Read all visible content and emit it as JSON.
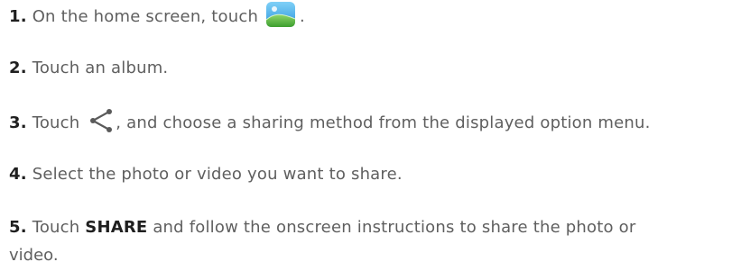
{
  "steps": [
    {
      "number": "1.",
      "text_before": "On the home screen, touch",
      "icon": "gallery-icon",
      "text_after": "."
    },
    {
      "number": "2.",
      "text": "Touch an album."
    },
    {
      "number": "3.",
      "text_before": "Touch",
      "icon": "share-icon",
      "text_after": ", and choose a sharing method from the displayed option menu."
    },
    {
      "number": "4.",
      "text": "Select the photo or video you want to share."
    },
    {
      "number": "5.",
      "text_before": "Touch",
      "bold": "SHARE",
      "text_after": "and follow the onscreen instructions to share the photo or",
      "continuation": "video."
    }
  ],
  "colors": {
    "text": "#5f5f5f",
    "number": "#1f1f1f",
    "gallery_sky": "#3aa7e8",
    "gallery_grass": "#5cc04a"
  }
}
